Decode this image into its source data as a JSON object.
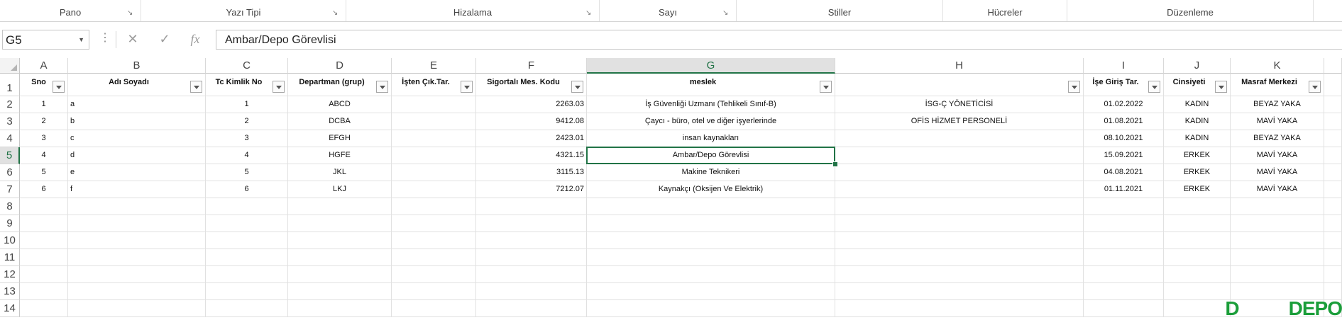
{
  "ribbon": {
    "groups": [
      {
        "label": "Pano",
        "launcher": true
      },
      {
        "label": "Yazı Tipi",
        "launcher": true
      },
      {
        "label": "Hizalama",
        "launcher": true
      },
      {
        "label": "Sayı",
        "launcher": true
      },
      {
        "label": "Stiller",
        "launcher": false
      },
      {
        "label": "Hücreler",
        "launcher": false
      },
      {
        "label": "Düzenleme",
        "launcher": false
      }
    ]
  },
  "formula_bar": {
    "name_box": "G5",
    "cancel_icon": "✕",
    "enter_icon": "✓",
    "function_icon": "fx",
    "value": "Ambar/Depo Görevlisi"
  },
  "columns": [
    "A",
    "B",
    "C",
    "D",
    "E",
    "F",
    "G",
    "H",
    "I",
    "J",
    "K"
  ],
  "rows": [
    "1",
    "2",
    "3",
    "4",
    "5",
    "6",
    "7",
    "8",
    "9",
    "10",
    "11",
    "12",
    "13",
    "14"
  ],
  "selected": {
    "column": "G",
    "row": "5"
  },
  "table": {
    "headers": [
      "Sno",
      "Adı Soyadı",
      "Tc Kimlik No",
      "Departman (grup)",
      "İşten Çık.Tar.",
      "Sigortalı Mes. Kodu",
      "meslek",
      "",
      "İşe Giriş Tar.",
      "Cinsiyeti",
      "Masraf Merkezi"
    ],
    "rows": [
      [
        "1",
        "a",
        "1",
        "ABCD",
        "",
        "2263.03",
        "İş Güvenliği Uzmanı (Tehlikeli Sınıf-B)",
        "İSG-Ç  YÖNETİCİSİ",
        "01.02.2022",
        "KADIN",
        "BEYAZ YAKA"
      ],
      [
        "2",
        "b",
        "2",
        "DCBA",
        "",
        "9412.08",
        "Çaycı - büro, otel ve diğer işyerlerinde",
        "OFİS HİZMET PERSONELİ",
        "01.08.2021",
        "KADIN",
        "MAVİ YAKA"
      ],
      [
        "3",
        "c",
        "3",
        "EFGH",
        "",
        "2423.01",
        "insan kaynakları",
        "",
        "08.10.2021",
        "KADIN",
        "BEYAZ YAKA"
      ],
      [
        "4",
        "d",
        "4",
        "HGFE",
        "",
        "4321.15",
        "Ambar/Depo Görevlisi",
        "",
        "15.09.2021",
        "ERKEK",
        "MAVİ YAKA"
      ],
      [
        "5",
        "e",
        "5",
        "JKL",
        "",
        "3115.13",
        "Makine Teknikeri",
        "",
        "04.08.2021",
        "ERKEK",
        "MAVİ YAKA"
      ],
      [
        "6",
        "f",
        "6",
        "LKJ",
        "",
        "7212.07",
        "Kaynakçı (Oksijen Ve Elektrik)",
        "",
        "01.11.2021",
        "ERKEK",
        "MAVİ YAKA"
      ]
    ]
  },
  "watermark": {
    "text": "DEPO",
    "prefix": "D"
  },
  "colors": {
    "accent": "#217346",
    "watermark": "#1b9e3a"
  }
}
